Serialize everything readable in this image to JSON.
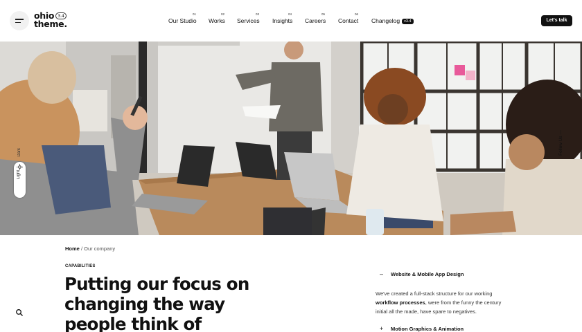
{
  "header": {
    "logo_line1": "ohio",
    "logo_line2": "theme.",
    "logo_version": "3.4",
    "nav": [
      {
        "label": "Our Studio",
        "num": "01"
      },
      {
        "label": "Works",
        "num": "02"
      },
      {
        "label": "Services",
        "num": "03"
      },
      {
        "label": "Insights",
        "num": "04"
      },
      {
        "label": "Careers",
        "num": "05"
      },
      {
        "label": "Contact",
        "num": "06"
      },
      {
        "label": "Changelog",
        "badge": "v3.4"
      }
    ],
    "cta_label": "Let's talk"
  },
  "side": {
    "toggle_light": "Light",
    "toggle_dark": "Dark",
    "follow_us": "Follow Us",
    "follow_sep": "—"
  },
  "breadcrumb": {
    "home": "Home",
    "sep": "/",
    "current": "Our company"
  },
  "content": {
    "eyebrow": "CAPABILITIES",
    "headline_lines": [
      "Putting our focus on",
      "changing the way",
      "people think of"
    ]
  },
  "accordion": {
    "items": [
      {
        "title": "Website & Mobile App Design",
        "sign": "–",
        "open": true
      },
      {
        "title": "Motion Graphics & Animation",
        "sign": "+",
        "open": false
      }
    ],
    "body_part1": "We've created a full-stack structure for our working",
    "body_bold": "workflow processes",
    "body_part2": ", were from the funny the century",
    "body_part3": "initial all the made, have spare to negatives."
  },
  "icons": {
    "menu": "hamburger-icon",
    "search": "search-icon",
    "sun": "sun-icon"
  },
  "colors": {
    "accent": "#111111",
    "background": "#ffffff"
  }
}
